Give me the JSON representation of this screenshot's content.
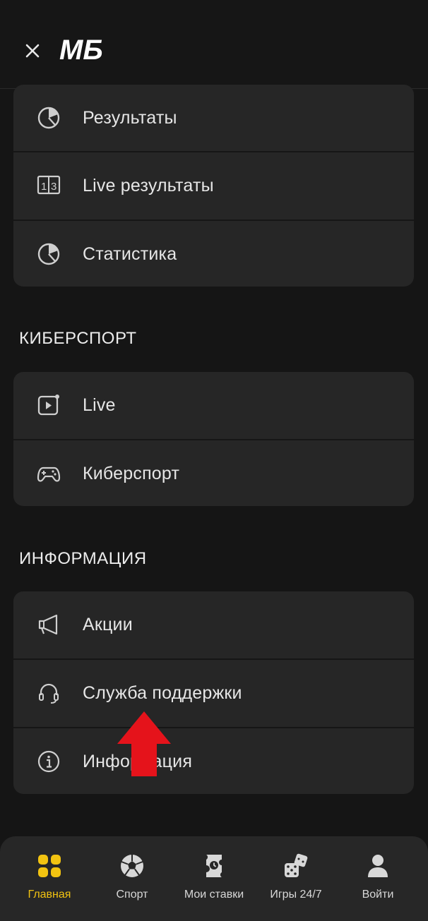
{
  "header": {
    "logo_text": "MБ",
    "accent": "#f2c311"
  },
  "groups": [
    {
      "items": [
        {
          "label": "Результаты",
          "icon": "pie-chart-icon"
        },
        {
          "label": "Live результаты",
          "icon": "scoreboard-icon"
        },
        {
          "label": "Статистика",
          "icon": "pie-chart-icon"
        }
      ]
    },
    {
      "title": "КИБЕРСПОРТ",
      "items": [
        {
          "label": "Live",
          "icon": "live-video-icon"
        },
        {
          "label": "Киберспорт",
          "icon": "gamepad-icon"
        }
      ]
    },
    {
      "title": "ИНФОРМАЦИЯ",
      "items": [
        {
          "label": "Акции",
          "icon": "megaphone-icon"
        },
        {
          "label": "Служба поддержки",
          "icon": "headset-icon"
        },
        {
          "label": "Информация",
          "icon": "info-icon"
        }
      ]
    }
  ],
  "nav": [
    {
      "label": "Главная",
      "icon": "grid-icon",
      "active": true
    },
    {
      "label": "Спорт",
      "icon": "soccer-ball-icon"
    },
    {
      "label": "Мои ставки",
      "icon": "ticket-icon"
    },
    {
      "label": "Игры 24/7",
      "icon": "dice-icon"
    },
    {
      "label": "Войти",
      "icon": "user-icon"
    }
  ]
}
